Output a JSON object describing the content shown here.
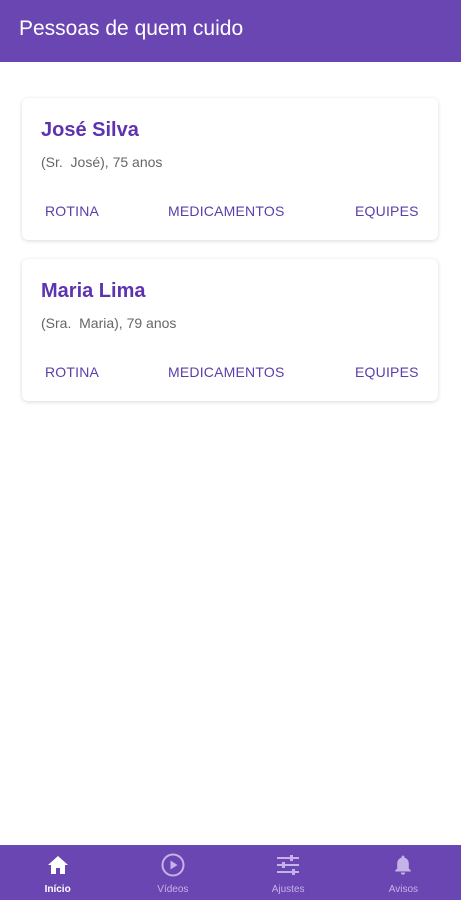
{
  "app_bar": {
    "title": "Pessoas de quem cuido"
  },
  "people": [
    {
      "name": "José Silva",
      "subtitle": "(Sr.  José), 75 anos",
      "actions": [
        "ROTINA",
        "MEDICAMENTOS",
        "EQUIPES"
      ]
    },
    {
      "name": "Maria Lima",
      "subtitle": "(Sra.  Maria), 79 anos",
      "actions": [
        "ROTINA",
        "MEDICAMENTOS",
        "EQUIPES"
      ]
    }
  ],
  "bottom_nav": {
    "items": [
      {
        "label": "Início",
        "icon": "home-icon",
        "active": true
      },
      {
        "label": "Vídeos",
        "icon": "play-circle-icon",
        "active": false
      },
      {
        "label": "Ajustes",
        "icon": "sliders-icon",
        "active": false
      },
      {
        "label": "Avisos",
        "icon": "bell-icon",
        "active": false
      }
    ]
  },
  "colors": {
    "primary": "#6a46b3",
    "name_text": "#5e33b0",
    "action_text": "#5a3fa8",
    "inactive_nav": "#c4b3e6"
  }
}
